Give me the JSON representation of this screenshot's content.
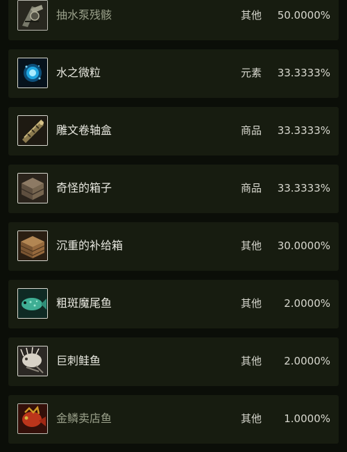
{
  "drops": [
    {
      "name": "抽水泵残骸",
      "category": "其他",
      "rate": "50.0000%",
      "icon": "pump-wreckage-icon"
    },
    {
      "name": "水之微粒",
      "category": "元素",
      "rate": "33.3333%",
      "icon": "water-mote-icon"
    },
    {
      "name": "雕文卷轴盒",
      "category": "商品",
      "rate": "33.3333%",
      "icon": "scroll-case-icon"
    },
    {
      "name": "奇怪的箱子",
      "category": "商品",
      "rate": "33.3333%",
      "icon": "strange-crate-icon"
    },
    {
      "name": "沉重的补给箱",
      "category": "其他",
      "rate": "30.0000%",
      "icon": "supply-crate-icon"
    },
    {
      "name": "粗斑魔尾鱼",
      "category": "其他",
      "rate": "2.0000%",
      "icon": "spotted-fish-icon"
    },
    {
      "name": "巨刺鲑鱼",
      "category": "其他",
      "rate": "2.0000%",
      "icon": "spiny-salmon-icon"
    },
    {
      "name": "金鳞卖店鱼",
      "category": "其他",
      "rate": "1.0000%",
      "icon": "golden-fish-icon"
    }
  ],
  "colors": {
    "background": "#0b0e08",
    "row": "#171c10",
    "text": "#e8e8e0",
    "dim_text": "#9aa08a"
  }
}
